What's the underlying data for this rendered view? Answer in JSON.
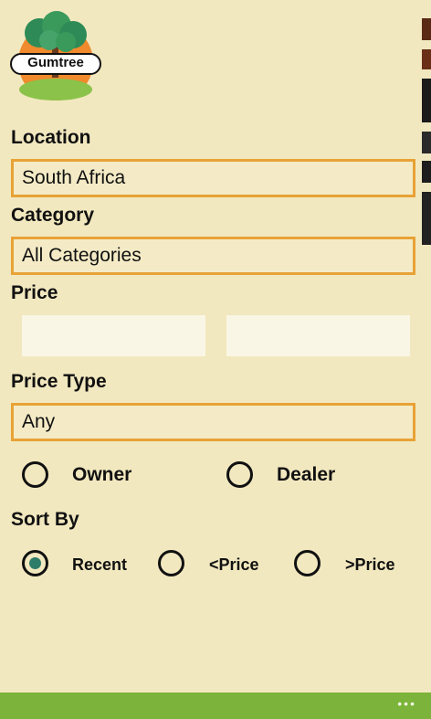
{
  "logo": {
    "text": "Gumtree"
  },
  "location": {
    "label": "Location",
    "value": "South Africa"
  },
  "category": {
    "label": "Category",
    "value": "All Categories"
  },
  "price": {
    "label": "Price",
    "min_value": "",
    "max_value": ""
  },
  "price_type": {
    "label": "Price Type",
    "value": "Any"
  },
  "seller": {
    "options": [
      "Owner",
      "Dealer"
    ],
    "selected": null
  },
  "sort_by": {
    "label": "Sort By",
    "options": [
      "Recent",
      "<Price",
      ">Price"
    ],
    "selected": "Recent"
  },
  "appbar": {
    "more": "•••"
  },
  "colors": {
    "background": "#f2e8bf",
    "accent_border": "#e8a236",
    "app_bar": "#7cb33a",
    "radio_fill": "#2e7d6a"
  }
}
